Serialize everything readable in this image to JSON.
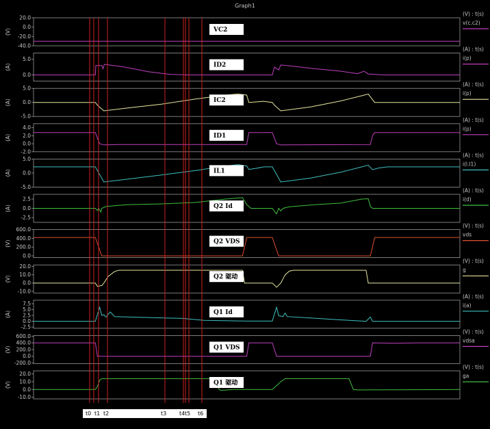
{
  "title": "Graph1",
  "chart_data": {
    "type": "line",
    "title": "Graph1",
    "time_markers": [
      "t0",
      "t1",
      "t2",
      "t3",
      "t4",
      "t5",
      "t6"
    ],
    "panels": [
      {
        "key": "vc2",
        "unit": "(V)",
        "legend_top": "(V) : t(s)",
        "legend": "v(c.c2)",
        "label": "VC2",
        "color": "#c040c0",
        "ticks": [
          "20.0",
          "0.0",
          "-20.0",
          "-40.0"
        ],
        "ylim": [
          -40,
          20
        ],
        "series": [
          [
            0,
            -30
          ],
          [
            1,
            -30
          ]
        ]
      },
      {
        "key": "id2",
        "unit": "(A)",
        "legend_top": "(A) : t(s)",
        "legend": "i(p)",
        "label": "ID2",
        "color": "#c040c0",
        "ticks": [
          "5.0",
          "0.0"
        ],
        "ylim": [
          -2,
          7
        ],
        "series": [
          [
            0,
            0
          ],
          [
            0.145,
            0
          ],
          [
            0.146,
            3
          ],
          [
            0.16,
            3
          ],
          [
            0.163,
            2
          ],
          [
            0.166,
            3.4
          ],
          [
            0.21,
            2.6
          ],
          [
            0.27,
            1
          ],
          [
            0.32,
            0.2
          ],
          [
            0.36,
            0
          ],
          [
            0.41,
            0
          ],
          [
            0.56,
            0
          ],
          [
            0.565,
            2.5
          ],
          [
            0.575,
            1.6
          ],
          [
            0.58,
            3.2
          ],
          [
            0.6,
            2.9
          ],
          [
            0.66,
            2
          ],
          [
            0.72,
            1.2
          ],
          [
            0.76,
            0.4
          ],
          [
            0.775,
            1.2
          ],
          [
            0.785,
            0.3
          ],
          [
            0.82,
            0
          ],
          [
            1,
            0
          ]
        ]
      },
      {
        "key": "ic2",
        "unit": "(A)",
        "legend_top": "(A) : t(s)",
        "legend": "i(p)",
        "label": "IC2",
        "color": "#e8e8a0",
        "ticks": [
          "5.0",
          "0.0",
          "-5.0"
        ],
        "ylim": [
          -5,
          5
        ],
        "series": [
          [
            0,
            0
          ],
          [
            0.145,
            0
          ],
          [
            0.15,
            -1
          ],
          [
            0.165,
            -3
          ],
          [
            0.22,
            -2
          ],
          [
            0.3,
            -0.6
          ],
          [
            0.38,
            1.2
          ],
          [
            0.45,
            2.6
          ],
          [
            0.48,
            3
          ],
          [
            0.5,
            2.6
          ],
          [
            0.505,
            0
          ],
          [
            0.54,
            0.4
          ],
          [
            0.56,
            0
          ],
          [
            0.565,
            -1
          ],
          [
            0.58,
            -3
          ],
          [
            0.65,
            -1.6
          ],
          [
            0.72,
            0.5
          ],
          [
            0.77,
            2.4
          ],
          [
            0.785,
            3
          ],
          [
            0.795,
            1
          ],
          [
            0.8,
            0
          ],
          [
            1,
            0
          ]
        ]
      },
      {
        "key": "id1",
        "unit": "(A)",
        "legend_top": "(A) : t(s)",
        "legend": "i(p)",
        "label": "ID1",
        "color": "#c040c0",
        "ticks": [
          "4.0",
          "2.0",
          "0.0",
          "-2.0"
        ],
        "ylim": [
          -2,
          5
        ],
        "series": [
          [
            0,
            2.8
          ],
          [
            0.145,
            2.8
          ],
          [
            0.155,
            0
          ],
          [
            0.165,
            -0.3
          ],
          [
            0.2,
            -0.2
          ],
          [
            0.5,
            -0.2
          ],
          [
            0.505,
            2.8
          ],
          [
            0.56,
            2.8
          ],
          [
            0.57,
            0
          ],
          [
            0.58,
            -0.3
          ],
          [
            0.79,
            -0.2
          ],
          [
            0.795,
            2
          ],
          [
            0.8,
            2.8
          ],
          [
            1,
            2.8
          ]
        ]
      },
      {
        "key": "il1",
        "unit": "(A)",
        "legend_top": "(A) : t(s)",
        "legend": "i(l.l1)",
        "label": "IL1",
        "color": "#40c0c0",
        "ticks": [
          "5.0",
          "0.0",
          "-5.0"
        ],
        "ylim": [
          -5,
          5
        ],
        "series": [
          [
            0,
            2.2
          ],
          [
            0.145,
            2.2
          ],
          [
            0.165,
            -3.2
          ],
          [
            0.22,
            -2.2
          ],
          [
            0.3,
            -0.7
          ],
          [
            0.38,
            0.9
          ],
          [
            0.45,
            2.5
          ],
          [
            0.48,
            3
          ],
          [
            0.5,
            2.5
          ],
          [
            0.505,
            1.3
          ],
          [
            0.52,
            1.6
          ],
          [
            0.54,
            2.2
          ],
          [
            0.56,
            2.2
          ],
          [
            0.58,
            -3.2
          ],
          [
            0.65,
            -1.8
          ],
          [
            0.72,
            0.3
          ],
          [
            0.77,
            2.2
          ],
          [
            0.785,
            2.8
          ],
          [
            0.795,
            1.2
          ],
          [
            0.81,
            1.8
          ],
          [
            0.83,
            2.2
          ],
          [
            1,
            2.2
          ]
        ]
      },
      {
        "key": "q2id",
        "unit": "(A)",
        "legend_top": "(A) : t(s)",
        "legend": "i(d)",
        "label": "Q2 Id",
        "color": "#40c040",
        "ticks": [
          "2.5",
          "0.0",
          "-2.5"
        ],
        "ylim": [
          -3.8,
          3.8
        ],
        "series": [
          [
            0,
            0
          ],
          [
            0.145,
            0
          ],
          [
            0.15,
            -0.6
          ],
          [
            0.153,
            0
          ],
          [
            0.158,
            -1
          ],
          [
            0.16,
            0
          ],
          [
            0.17,
            0.5
          ],
          [
            0.22,
            1
          ],
          [
            0.3,
            1.2
          ],
          [
            0.38,
            1.6
          ],
          [
            0.45,
            2.5
          ],
          [
            0.48,
            2.8
          ],
          [
            0.49,
            2.9
          ],
          [
            0.5,
            1
          ],
          [
            0.51,
            0
          ],
          [
            0.56,
            0
          ],
          [
            0.565,
            -0.8
          ],
          [
            0.57,
            -1.5
          ],
          [
            0.575,
            0
          ],
          [
            0.58,
            -0.7
          ],
          [
            0.585,
            0
          ],
          [
            0.6,
            0.4
          ],
          [
            0.66,
            1
          ],
          [
            0.72,
            1.4
          ],
          [
            0.77,
            2.5
          ],
          [
            0.785,
            2.6
          ],
          [
            0.79,
            0.5
          ],
          [
            0.795,
            0
          ],
          [
            1,
            0
          ]
        ]
      },
      {
        "key": "q2vds",
        "unit": "(V)",
        "legend_top": "(V) : t(s)",
        "legend": "vds",
        "label": "Q2 VDS",
        "color": "#e05030",
        "ticks": [
          "600.0",
          "400.0",
          "200.0",
          "0.0"
        ],
        "ylim": [
          -40,
          600
        ],
        "series": [
          [
            0,
            420
          ],
          [
            0.145,
            420
          ],
          [
            0.16,
            0
          ],
          [
            0.49,
            0
          ],
          [
            0.5,
            420
          ],
          [
            0.56,
            420
          ],
          [
            0.575,
            0
          ],
          [
            0.79,
            0
          ],
          [
            0.8,
            420
          ],
          [
            1,
            420
          ]
        ]
      },
      {
        "key": "q2g",
        "unit": "(V)",
        "legend_top": "(V) : t(s)",
        "legend": "g",
        "label": "Q2 驱动",
        "color": "#e8e8a0",
        "ticks": [
          "20.0",
          "10.0",
          "0.0",
          "-10.0"
        ],
        "ylim": [
          -12,
          22
        ],
        "series": [
          [
            0,
            0
          ],
          [
            0.145,
            0
          ],
          [
            0.15,
            -4
          ],
          [
            0.16,
            -3
          ],
          [
            0.165,
            0
          ],
          [
            0.175,
            8
          ],
          [
            0.19,
            14
          ],
          [
            0.2,
            15.5
          ],
          [
            0.49,
            15.5
          ],
          [
            0.495,
            0
          ],
          [
            0.56,
            0
          ],
          [
            0.57,
            -5
          ],
          [
            0.58,
            0
          ],
          [
            0.59,
            10
          ],
          [
            0.6,
            14.5
          ],
          [
            0.61,
            15.5
          ],
          [
            0.78,
            15.5
          ],
          [
            0.785,
            0
          ],
          [
            1,
            0
          ]
        ]
      },
      {
        "key": "q1id",
        "unit": "(A)",
        "legend_top": "(A) : t(s)",
        "legend": "i(a)",
        "label": "Q1 Id",
        "color": "#40c0c0",
        "ticks": [
          "7.5",
          "5.0",
          "2.5",
          "0.0",
          "-2.5"
        ],
        "ylim": [
          -3,
          9
        ],
        "series": [
          [
            0,
            0
          ],
          [
            0.145,
            0
          ],
          [
            0.155,
            6
          ],
          [
            0.16,
            2.5
          ],
          [
            0.165,
            2.8
          ],
          [
            0.17,
            1.8
          ],
          [
            0.18,
            4
          ],
          [
            0.19,
            2
          ],
          [
            0.25,
            1.7
          ],
          [
            0.35,
            1.2
          ],
          [
            0.4,
            0.4
          ],
          [
            0.5,
            0.1
          ],
          [
            0.56,
            0.1
          ],
          [
            0.57,
            6
          ],
          [
            0.575,
            2.4
          ],
          [
            0.585,
            2
          ],
          [
            0.59,
            3.5
          ],
          [
            0.595,
            2
          ],
          [
            0.65,
            1.4
          ],
          [
            0.72,
            0.6
          ],
          [
            0.77,
            0.1
          ],
          [
            0.78,
            0
          ],
          [
            0.79,
            1.8
          ],
          [
            0.795,
            0
          ],
          [
            0.83,
            0
          ],
          [
            1,
            0
          ]
        ]
      },
      {
        "key": "q1vds",
        "unit": "(V)",
        "legend_top": "(V) : t(s)",
        "legend": "vdsa",
        "label": "Q1 VDS",
        "color": "#c040c0",
        "ticks": [
          "600.0",
          "400.0",
          "200.0",
          "0.0",
          "-200.0"
        ],
        "ylim": [
          -220,
          620
        ],
        "series": [
          [
            0,
            400
          ],
          [
            0.145,
            400
          ],
          [
            0.15,
            0
          ],
          [
            0.5,
            0
          ],
          [
            0.505,
            400
          ],
          [
            0.56,
            400
          ],
          [
            0.57,
            0
          ],
          [
            0.79,
            0
          ],
          [
            0.795,
            400
          ],
          [
            0.85,
            390
          ],
          [
            0.9,
            400
          ],
          [
            1,
            400
          ]
        ]
      },
      {
        "key": "q1g",
        "unit": "(V)",
        "legend_top": "(V) : t(s)",
        "legend": "ga",
        "label": "Q1 驱动",
        "color": "#40c040",
        "ticks": [
          "20.0",
          "10.0",
          "0.0",
          "-10.0"
        ],
        "ylim": [
          -12,
          24
        ],
        "series": [
          [
            0,
            0
          ],
          [
            0.145,
            0
          ],
          [
            0.15,
            4
          ],
          [
            0.155,
            12
          ],
          [
            0.16,
            14
          ],
          [
            0.43,
            14
          ],
          [
            0.435,
            0
          ],
          [
            0.44,
            -1
          ],
          [
            0.47,
            0
          ],
          [
            0.5,
            0
          ],
          [
            0.56,
            0
          ],
          [
            0.58,
            10
          ],
          [
            0.59,
            14
          ],
          [
            0.74,
            14
          ],
          [
            0.75,
            0
          ],
          [
            0.76,
            -0.5
          ],
          [
            1,
            0
          ]
        ]
      }
    ]
  }
}
